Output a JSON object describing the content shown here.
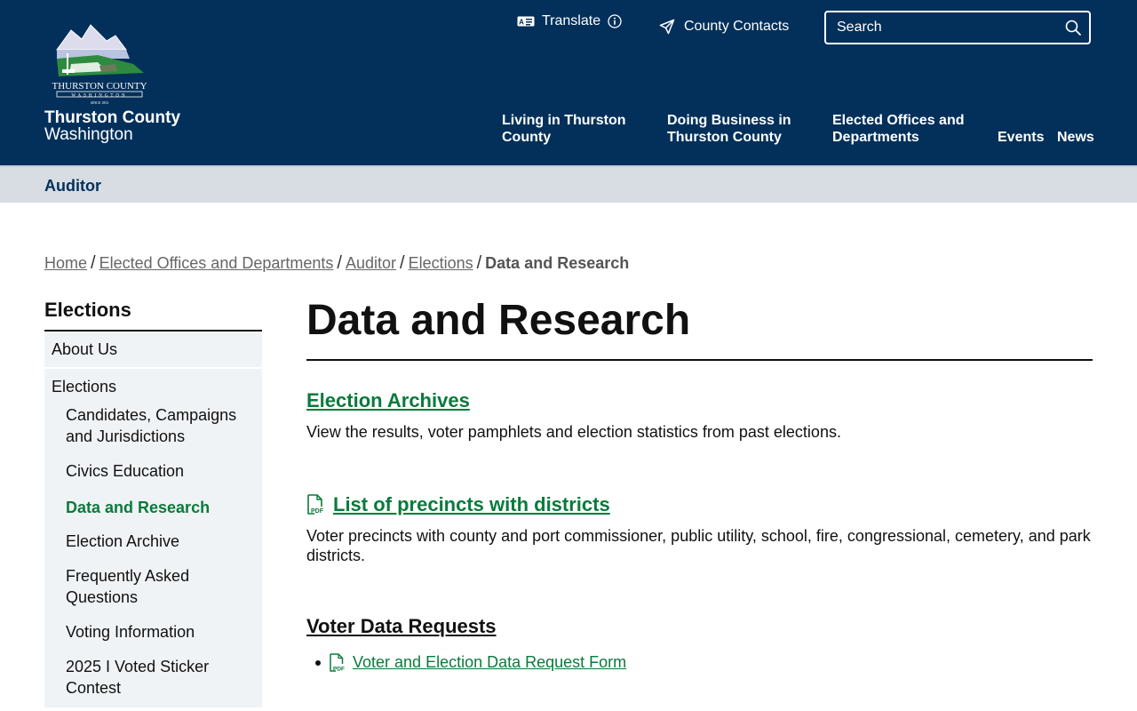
{
  "header": {
    "site_name_line1": "Thurston County",
    "site_name_line2": "Washington",
    "logo_alt": "THURSTON COUNTY",
    "translate_label": "Translate",
    "contacts_label": "County Contacts",
    "search_placeholder": "Search",
    "nav": {
      "living": "Living in Thurston County",
      "business": "Doing Business in Thurston County",
      "offices": "Elected Offices and Departments",
      "events": "Events",
      "news": "News"
    }
  },
  "dept_bar": {
    "label": "Auditor"
  },
  "breadcrumb": {
    "home": "Home",
    "offices": "Elected Offices and Departments",
    "auditor": "Auditor",
    "elections": "Elections",
    "current": "Data and Research"
  },
  "sidebar": {
    "title": "Elections",
    "about": "About Us",
    "elections": "Elections",
    "sub": [
      "Candidates, Campaigns and Jurisdictions",
      "Civics Education",
      "Data and Research",
      "Election Archive",
      "Frequently Asked Questions",
      "Voting Information",
      "2025 I Voted Sticker Contest"
    ]
  },
  "main": {
    "title": "Data and Research",
    "archives_link": "Election Archives",
    "archives_desc": "View the results, voter pamphlets and election statistics from past elections.",
    "precincts_link": "List of precincts with districts",
    "precincts_desc": "Voter precincts with county and port commissioner, public utility, school, fire, congressional, cemetery, and park districts.",
    "voter_data_heading": "Voter Data Requests",
    "request_form_link": "Voter and Election Data Request Form"
  },
  "colors": {
    "header_bg": "#03305a",
    "link_green": "#0a7a3c",
    "dept_bar_bg": "#d7dde3",
    "sidebar_bg": "#f0f3f6"
  }
}
